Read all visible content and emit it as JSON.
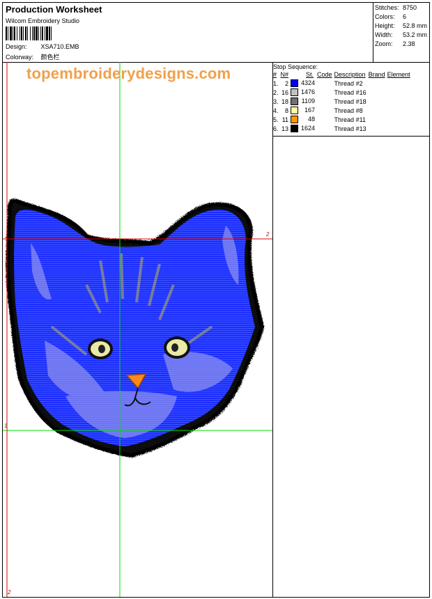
{
  "header": {
    "title": "Production Worksheet",
    "software": "Wilcom  Embroidery Studio",
    "design_label": "Design:",
    "design_value": "XSA710.EMB",
    "colorway_label": "Colorway:",
    "colorway_value": "颜色栏"
  },
  "stats": {
    "stitches_label": "Stitches:",
    "stitches_value": "8750",
    "colors_label": "Colors:",
    "colors_value": "6",
    "height_label": "Height:",
    "height_value": "52.8 mm",
    "width_label": "Width:",
    "width_value": "53.2 mm",
    "zoom_label": "Zoom:",
    "zoom_value": "2.38"
  },
  "stop_sequence": {
    "title": "Stop Sequence:",
    "columns": [
      "#",
      "N#",
      "St.",
      "Code",
      "Description",
      "Brand",
      "Element"
    ],
    "rows": [
      {
        "index": "1.",
        "n": "2",
        "color": "#0000ff",
        "stitches": "4324",
        "code": "",
        "description": "Thread #2",
        "brand": "",
        "element": ""
      },
      {
        "index": "2.",
        "n": "16",
        "color": "#c0c0c0",
        "stitches": "1476",
        "code": "",
        "description": "Thread #16",
        "brand": "",
        "element": ""
      },
      {
        "index": "3.",
        "n": "18",
        "color": "#707070",
        "stitches": "1109",
        "code": "",
        "description": "Thread #18",
        "brand": "",
        "element": ""
      },
      {
        "index": "4.",
        "n": "8",
        "color": "#ffff99",
        "stitches": "167",
        "code": "",
        "description": "Thread #8",
        "brand": "",
        "element": ""
      },
      {
        "index": "5.",
        "n": "11",
        "color": "#ff9900",
        "stitches": "48",
        "code": "",
        "description": "Thread #11",
        "brand": "",
        "element": ""
      },
      {
        "index": "6.",
        "n": "13",
        "color": "#000000",
        "stitches": "1624",
        "code": "",
        "description": "Thread #13",
        "brand": "",
        "element": ""
      }
    ]
  },
  "canvas": {
    "watermark": "topembroiderydesigns.com",
    "guide_label_top": "2",
    "guide_label_bottom": "2",
    "guide_label_left": "1"
  }
}
